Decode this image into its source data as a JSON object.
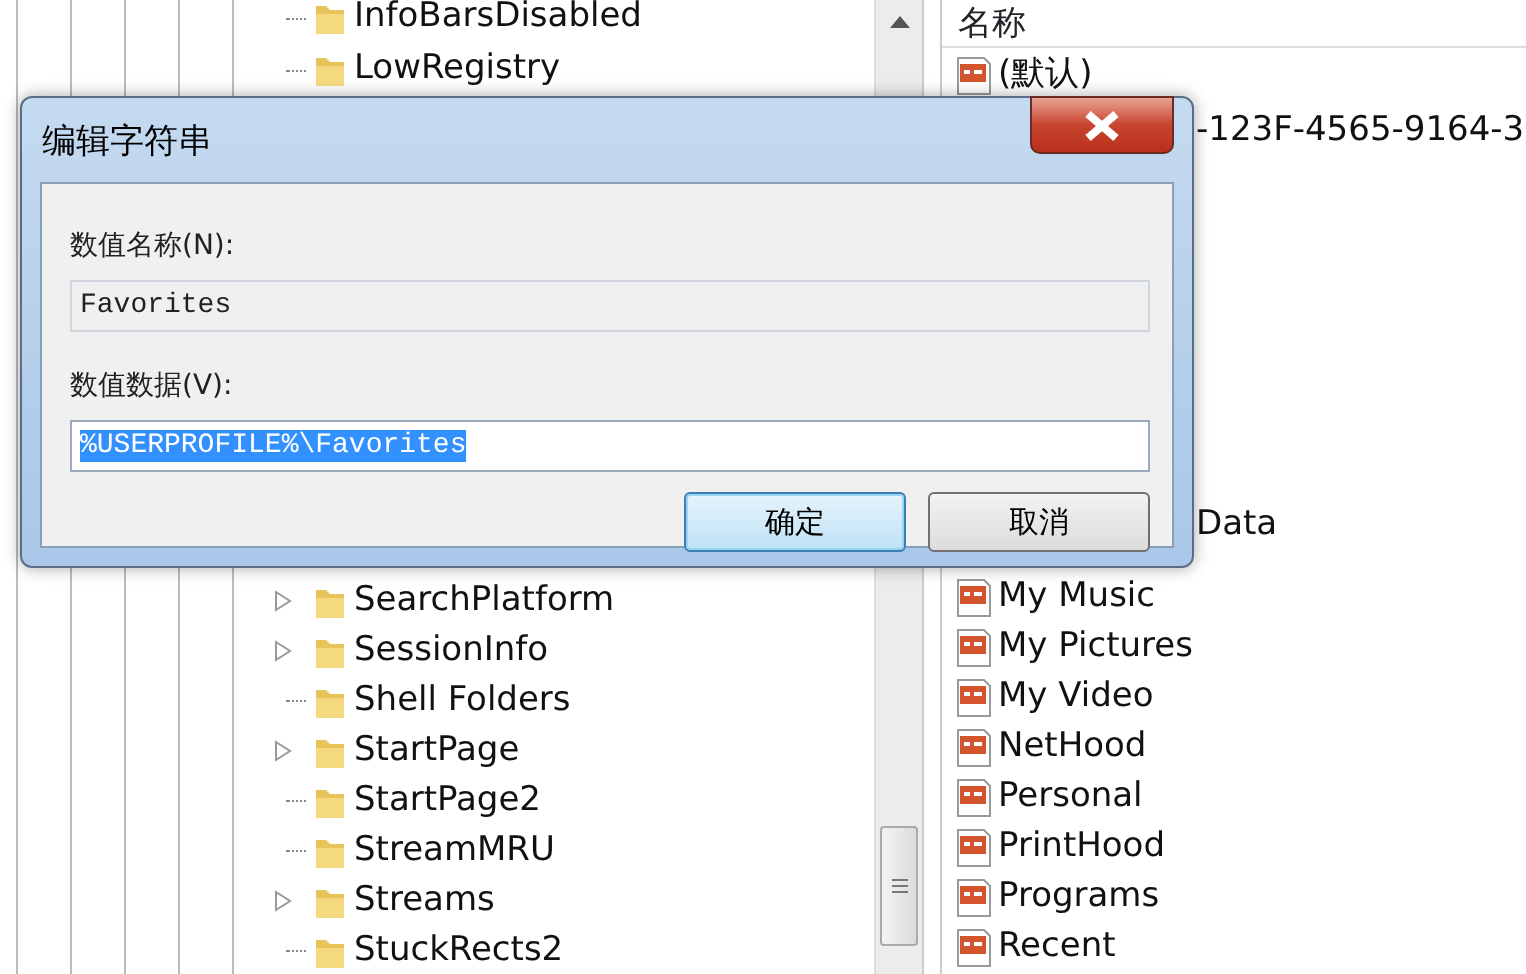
{
  "tree": {
    "items_above": [
      {
        "label": "InfoBarsDisabled",
        "expandable": false
      },
      {
        "label": "LowRegistry",
        "expandable": false
      }
    ],
    "items_below": [
      {
        "label": "SearchPlatform",
        "expandable": true
      },
      {
        "label": "SessionInfo",
        "expandable": true
      },
      {
        "label": "Shell Folders",
        "expandable": false
      },
      {
        "label": "StartPage",
        "expandable": true
      },
      {
        "label": "StartPage2",
        "expandable": false
      },
      {
        "label": "StreamMRU",
        "expandable": false
      },
      {
        "label": "Streams",
        "expandable": true
      },
      {
        "label": "StuckRects2",
        "expandable": false
      }
    ]
  },
  "values": {
    "column_header": "名称",
    "rows_above": [
      {
        "name": "(默认)",
        "kind": "full"
      },
      {
        "name": "-123F-4565-9164-3",
        "kind": "partial"
      }
    ],
    "rows_below": [
      {
        "name": "Data",
        "kind": "partial"
      },
      {
        "name": "My Music",
        "kind": "full"
      },
      {
        "name": "My Pictures",
        "kind": "full"
      },
      {
        "name": "My Video",
        "kind": "full"
      },
      {
        "name": "NetHood",
        "kind": "full"
      },
      {
        "name": "Personal",
        "kind": "full"
      },
      {
        "name": "PrintHood",
        "kind": "full"
      },
      {
        "name": "Programs",
        "kind": "full"
      },
      {
        "name": "Recent",
        "kind": "full"
      }
    ]
  },
  "dialog": {
    "title": "编辑字符串",
    "name_label": "数值名称(N):",
    "name_value": "Favorites",
    "data_label": "数值数据(V):",
    "data_value": "%USERPROFILE%\\Favorites",
    "data_selected": true,
    "buttons": [
      {
        "label": "确定",
        "default": true
      },
      {
        "label": "取消",
        "default": false
      }
    ]
  }
}
